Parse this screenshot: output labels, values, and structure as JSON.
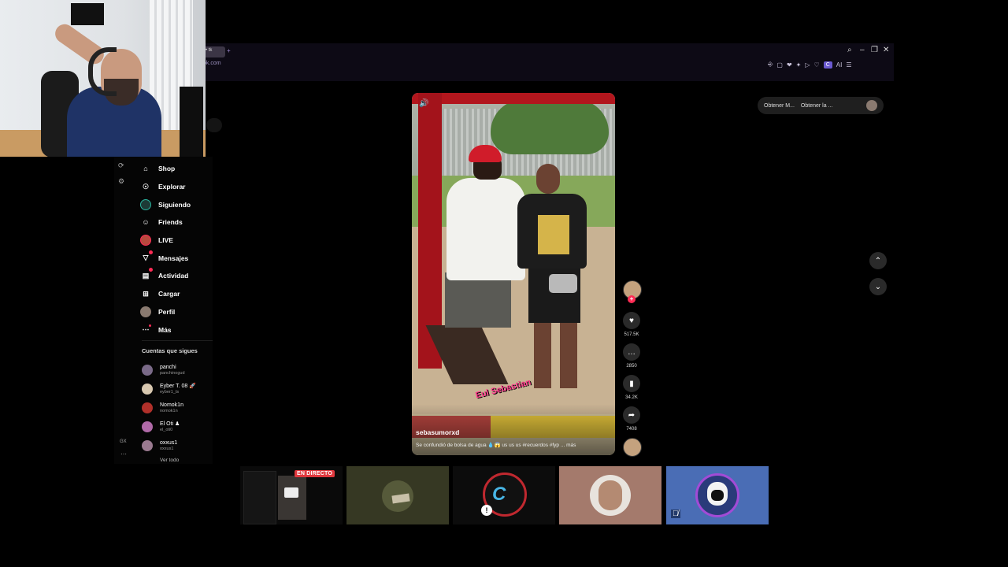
{
  "browser": {
    "tab_label": "• tk",
    "new_tab": "+",
    "url": "ok.com",
    "window_controls": [
      "⌕",
      "–",
      "❐",
      "✕"
    ],
    "toolbar_icons": [
      "⎆",
      "▢",
      "❤",
      "✦",
      "▷",
      "♡"
    ],
    "toolbar_c": "C",
    "toolbar_ai": "AI",
    "menu": "☰"
  },
  "top_pill": {
    "item1": "Obtener M...",
    "item2": "Obtener la ..."
  },
  "sidebar": {
    "nav": [
      {
        "label": "Shop",
        "icon": "shop-icon",
        "glyph": "⌂"
      },
      {
        "label": "Explorar",
        "icon": "compass-icon",
        "glyph": "☉"
      },
      {
        "label": "Siguiendo",
        "icon": "following-avatar-icon",
        "glyph": ""
      },
      {
        "label": "Friends",
        "icon": "friends-icon",
        "glyph": "☺"
      },
      {
        "label": "LIVE",
        "icon": "live-avatar-icon",
        "glyph": ""
      },
      {
        "label": "Mensajes",
        "icon": "messages-icon",
        "glyph": "▽"
      },
      {
        "label": "Actividad",
        "icon": "activity-icon",
        "glyph": "▤"
      },
      {
        "label": "Cargar",
        "icon": "upload-icon",
        "glyph": "⊞"
      },
      {
        "label": "Perfil",
        "icon": "profile-avatar-icon",
        "glyph": ""
      },
      {
        "label": "Más",
        "icon": "more-icon",
        "glyph": "⋯"
      }
    ],
    "following_title": "Cuentas que sigues",
    "following": [
      {
        "name": "panchi",
        "handle": "panchinogud",
        "color": "#7a6a88"
      },
      {
        "name": "Eyber T. 08 🚀",
        "handle": "eyber1_ts",
        "color": "#d8c8b0"
      },
      {
        "name": "Nomok1n",
        "handle": "nomok1n",
        "color": "#b0302a"
      },
      {
        "name": "El Oti ♟",
        "handle": "el_oti0",
        "color": "#b06aa8"
      },
      {
        "name": "oxxus1",
        "handle": "oxxus1",
        "color": "#9a7a90"
      }
    ],
    "see_all": "Ver todo",
    "gx": "GX",
    "dots": "⋯"
  },
  "video": {
    "author": "sebasumorxd",
    "caption": "Se confundió de bolsa de agua 💧😱 us us us #recuerdos #fyp ... más",
    "sticker": "Eul Sebastian",
    "volume_icon": "🔊"
  },
  "actions": {
    "likes": "517.5K",
    "comments": "2850",
    "saves": "34.2K",
    "shares": "7408",
    "plus": "+",
    "like_glyph": "♥",
    "comment_glyph": "…",
    "save_glyph": "▮",
    "share_glyph": "➦"
  },
  "nav_arrows": {
    "up": "⌃",
    "down": "⌄"
  },
  "participants": {
    "live_badge": "EN DIRECTO"
  },
  "colors": {
    "accent": "#fe2c55",
    "browser_bar": "#0d0a15",
    "opera_purple": "#6b5ad1"
  }
}
